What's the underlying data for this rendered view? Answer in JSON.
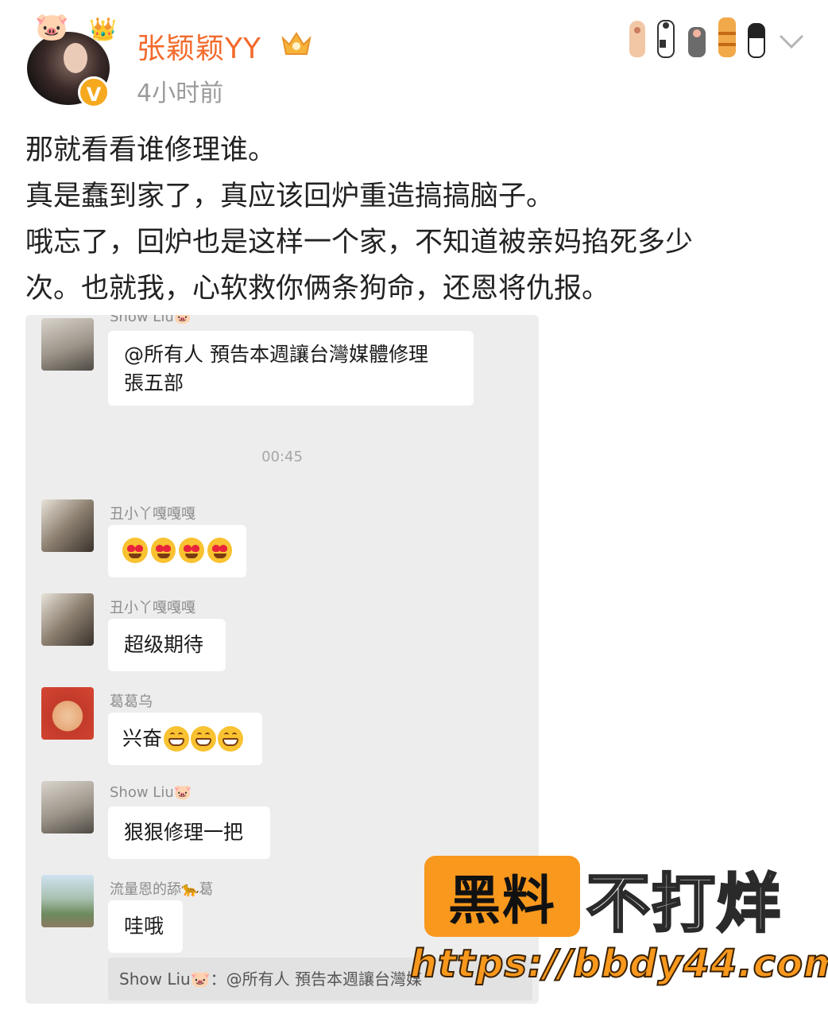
{
  "post": {
    "username": "张颖颖YY",
    "time": "4小时前",
    "lines": [
      "那就看看谁修理谁。",
      "真是蠢到家了，真应该回炉重造搞搞脑子。",
      "哦忘了，回炉也是这样一个家，不知道被亲妈掐死多少",
      "次。也就我，心软救你俩条狗命，还恩将仇报。"
    ]
  },
  "chat": {
    "partial_nick": "Show Liu🐷",
    "first_msg_line1": "@所有人  預告本週讓台灣媒體修理",
    "first_msg_line2": "張五部",
    "time": "00:45",
    "messages": [
      {
        "nick": "丑小丫嘎嘎嘎",
        "text": ""
      },
      {
        "nick": "丑小丫嘎嘎嘎",
        "text": "超级期待"
      },
      {
        "nick": "葛葛乌",
        "text": "兴奋"
      },
      {
        "nick": "Show Liu🐷",
        "text": "狠狠修理一把"
      },
      {
        "nick": "流量恩的舔🐆葛",
        "text": "哇哦"
      }
    ],
    "quote": "Show Liu🐷：@所有人 預告本週讓台灣媒"
  },
  "watermark": {
    "box_text": "黑料",
    "text": "不打烊",
    "url": "https://bbdy44.com"
  },
  "colors": {
    "username": "#f36a2c",
    "chat_bg": "#ededed",
    "watermark_orange": "#f8981d"
  },
  "icons": [
    "verified-badge-icon",
    "member-crown-icon",
    "cat-paws-decoration-icon",
    "chevron-down-icon"
  ]
}
